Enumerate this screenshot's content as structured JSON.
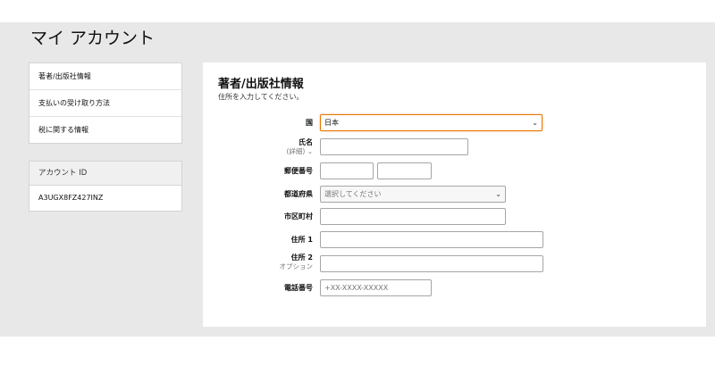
{
  "header": {
    "title": "マイ アカウント"
  },
  "sidebar": {
    "items": [
      {
        "label": "著者/出版社情報"
      },
      {
        "label": "支払いの受け取り方法"
      },
      {
        "label": "税に関する情報"
      }
    ]
  },
  "account": {
    "heading": "アカウント ID",
    "value": "A3UGX8FZ427INZ"
  },
  "form": {
    "title": "著者/出版社情報",
    "subtitle": "住所を入力してください。",
    "country": {
      "label": "国",
      "value": "日本"
    },
    "name": {
      "label": "氏名",
      "sublabel": "(詳細) ⌄",
      "value": ""
    },
    "postal": {
      "label": "郵便番号",
      "value1": "",
      "value2": ""
    },
    "prefecture": {
      "label": "都道府県",
      "placeholder": "選択してください"
    },
    "city": {
      "label": "市区町村",
      "value": ""
    },
    "address1": {
      "label": "住所 1",
      "value": ""
    },
    "address2": {
      "label": "住所 2",
      "sublabel": "オプション",
      "value": ""
    },
    "phone": {
      "label": "電話番号",
      "placeholder": "+XX-XXXX-XXXXX"
    }
  },
  "icons": {
    "dropdown": "chevron-down-icon"
  }
}
